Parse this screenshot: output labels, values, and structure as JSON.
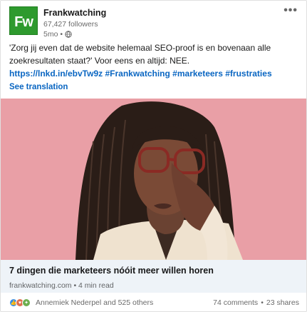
{
  "post": {
    "company": "Frankwatching",
    "logo_text": "Fw",
    "followers": "67,427 followers",
    "time": "5mo •",
    "body": "'Zorg jij even dat de website helemaal SEO-proof is en bovenaan alle zoekresultaten staat?' Voor eens en altijd: NEE.",
    "link": "https://lnkd.in/ebvTw9z",
    "hashtags": [
      "#Frankwatching",
      "#marketeers",
      "#frustraties"
    ],
    "see_translation": "See translation",
    "more_icon": "more-icon"
  },
  "article": {
    "title": "7 dingen die marketeers nóóit meer willen horen",
    "source": "frankwatching.com • 4 min read"
  },
  "social": {
    "reactions": [
      "like-icon",
      "love-icon",
      "celebrate-icon"
    ],
    "names": "Annemiek Nederpel and 525 others",
    "comments": "74 comments",
    "separator": "•",
    "shares": "23 shares"
  },
  "colors": {
    "brand_green": "#2e9a2e",
    "link_blue": "#0a66c2",
    "image_background": "#e99fa6"
  }
}
